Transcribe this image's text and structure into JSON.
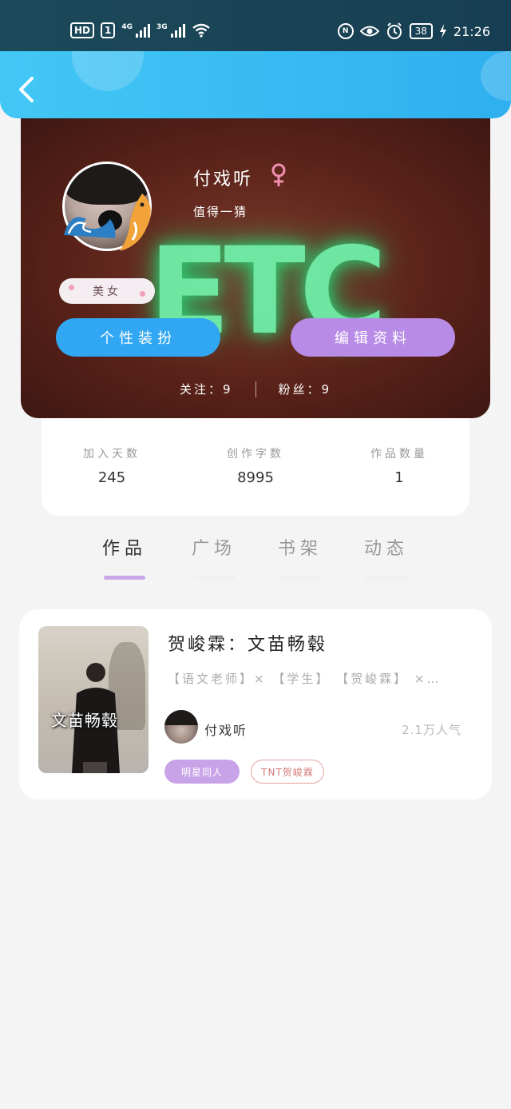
{
  "status_bar": {
    "hd": "HD",
    "sim": "1",
    "net1": "4G",
    "net2": "3G",
    "nfc_icon": "nfc-icon",
    "eye_icon": "eye-icon",
    "alarm_icon": "alarm-icon",
    "battery": "38",
    "time": "21:26"
  },
  "header": {
    "back_icon": "chevron-left-icon",
    "color": "#36b8f3"
  },
  "profile": {
    "username": "付戏听",
    "gender_icon": "female-icon",
    "signature": "值得一猜",
    "tag": "美女",
    "dress_button": "个性装扮",
    "edit_button": "编辑资料",
    "following": "关注：9",
    "followers": "粉丝：9"
  },
  "stats": [
    {
      "label": "加入天数",
      "value": "245"
    },
    {
      "label": "创作字数",
      "value": "8995"
    },
    {
      "label": "作品数量",
      "value": "1"
    }
  ],
  "tabs": [
    "作品",
    "广场",
    "书架",
    "动态"
  ],
  "work": {
    "title": "贺峻霖：文苗畅毂",
    "cover_text": "文苗畅毂",
    "tags": "【语文老师】× 【学生】 【贺峻霖】 ×…",
    "author": "付戏听",
    "popularity": "2.1万人气",
    "chips": [
      "明星同人",
      "TNT贺峻霖"
    ]
  },
  "colors": {
    "accent_blue": "#31a6f2",
    "accent_purple": "#b78be6",
    "tab_active": "#c8a8e8"
  }
}
